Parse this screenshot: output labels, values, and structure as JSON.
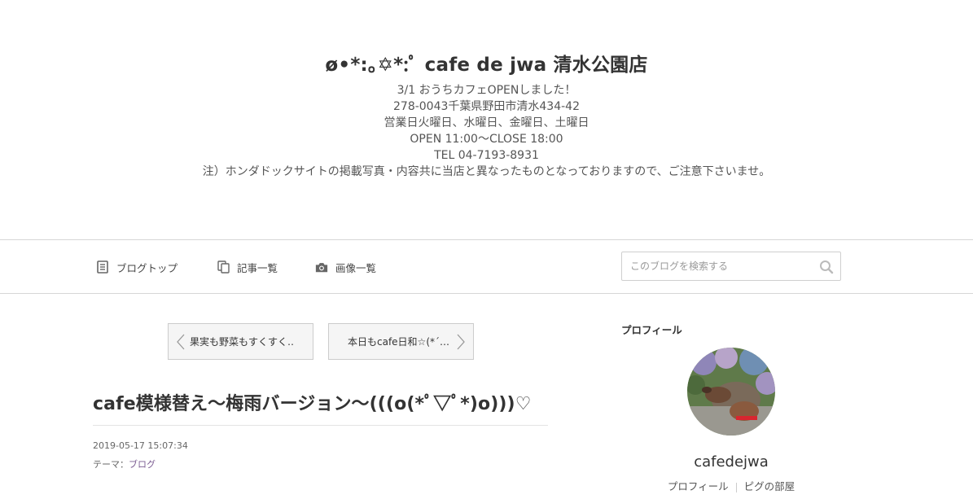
{
  "header": {
    "title": "ø•*:｡✡*:ﾟ cafe de jwa 清水公園店",
    "description": [
      "3/1 おうちカフェOPENしました！",
      "278-0043千葉県野田市清水434-42",
      "営業日火曜日、水曜日、金曜日、土曜日",
      "OPEN 11:00〜CLOSE 18:00",
      "TEL 04-7193-8931",
      "注）ホンダドックサイトの掲載写真・内容共に当店と異なったものとなっておりますので、ご注意下さいませ。"
    ]
  },
  "nav": {
    "items": [
      {
        "label": "ブログトップ",
        "icon": "document-icon"
      },
      {
        "label": "記事一覧",
        "icon": "copy-icon"
      },
      {
        "label": "画像一覧",
        "icon": "camera-icon"
      }
    ],
    "search": {
      "placeholder": "このブログを検索する",
      "value": ""
    }
  },
  "pager": {
    "prev_label": "果実も野菜もすくすく…",
    "next_label": "本日もcafe日和☆(*´…"
  },
  "entry": {
    "title": "cafe模様替え〜梅雨バージョン〜(((o(*ﾟ▽ﾟ*)o)))♡",
    "date": "2019-05-17 15:07:34",
    "theme_label": "テーマ：",
    "theme_value": "ブログ"
  },
  "profile": {
    "heading": "プロフィール",
    "name": "cafedejwa",
    "links": [
      "プロフィール",
      "ピグの部屋"
    ]
  },
  "colors": {
    "border": "#d7d7d7",
    "text": "#333333",
    "theme_link": "#7b5c92",
    "icon": "#666666"
  }
}
